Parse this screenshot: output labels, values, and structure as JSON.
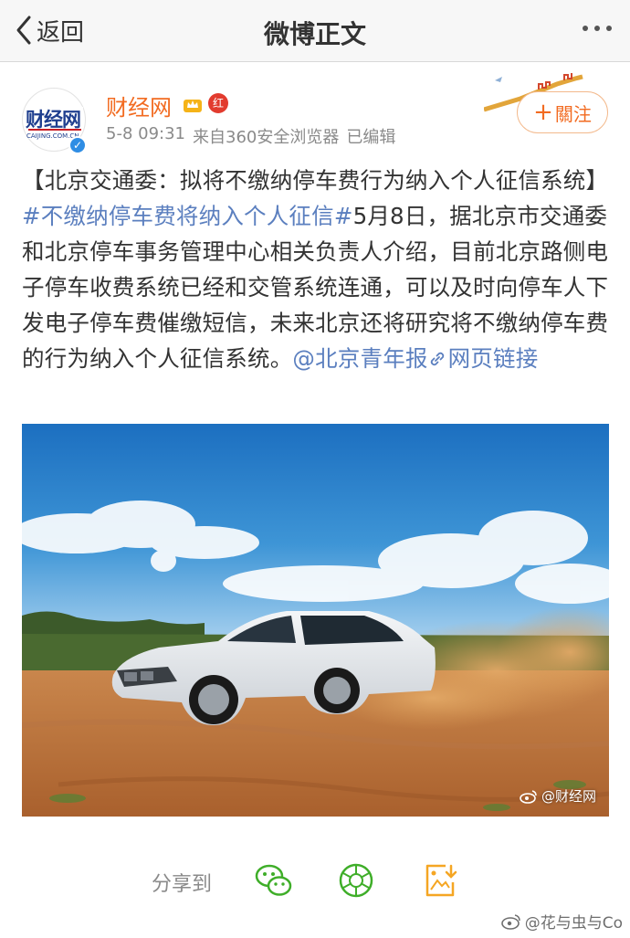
{
  "nav": {
    "back_label": "返回",
    "title": "微博正文"
  },
  "author": {
    "name": "财经网",
    "avatar_logo": "财经网",
    "avatar_sub": "CAIJING.COM.CN",
    "red_badge": "红",
    "time": "5-8 09:31",
    "source": "来自360安全浏览器",
    "edited": "已编辑",
    "follow_label": "關注"
  },
  "post": {
    "text_intro": "【北京交通委：拟将不缴纳停车费行为纳入个人征信系统】",
    "hashtag": "#不缴纳停车费将纳入个人征信#",
    "text_body": "5月8日，据北京市交通委和北京停车事务管理中心相关负责人介绍，目前北京路侧电子停车收费系统已经和交管系统连通，可以及时向停车人下发电子停车费催缴短信，未来北京还将研究将不缴纳停车费的行为纳入个人征信系统。",
    "mention": "@北京青年报",
    "web_link": "网页链接"
  },
  "image": {
    "watermark": "@财经网"
  },
  "share": {
    "label": "分享到"
  },
  "footer_watermark": "@花与虫与Co",
  "colors": {
    "accent_orange": "#f26b21",
    "link_blue": "#5b7fbf",
    "wechat_green": "#3fae29",
    "save_orange": "#f5a623"
  }
}
